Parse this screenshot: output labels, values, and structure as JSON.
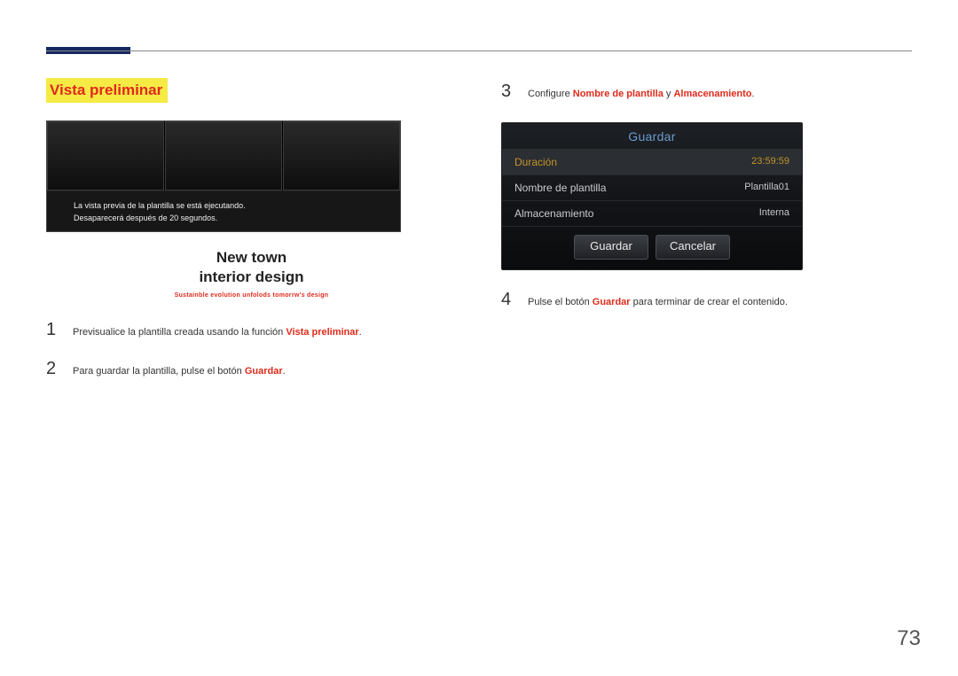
{
  "section_title": "Vista preliminar",
  "preview": {
    "msg_line1": "La vista previa de la plantilla se está ejecutando.",
    "msg_line2": "Desaparecerá después de 20 segundos.",
    "center_line1": "New town",
    "center_line2": "interior design",
    "center_sub": "Sustainble evolution unfolods tomorrw's design"
  },
  "left_steps": [
    {
      "num": "1",
      "pre": "Previsualice la plantilla creada usando la función ",
      "bold": "Vista preliminar",
      "post": "."
    },
    {
      "num": "2",
      "pre": "Para guardar la plantilla, pulse el botón ",
      "bold": "Guardar",
      "post": "."
    }
  ],
  "right_steps": {
    "s3": {
      "num": "3",
      "pre": "Configure ",
      "b1": "Nombre de plantilla",
      "mid": " y ",
      "b2": "Almacenamiento",
      "post": "."
    },
    "s4": {
      "num": "4",
      "pre": "Pulse el botón ",
      "bold": "Guardar",
      "post": " para terminar de crear el contenido."
    }
  },
  "dialog": {
    "title": "Guardar",
    "rows": [
      {
        "label": "Duración",
        "value": "23:59:59",
        "highlight": true
      },
      {
        "label": "Nombre de plantilla",
        "value": "Plantilla01",
        "highlight": false
      },
      {
        "label": "Almacenamiento",
        "value": "Interna",
        "highlight": false
      }
    ],
    "btn_save": "Guardar",
    "btn_cancel": "Cancelar"
  },
  "page_number": "73"
}
